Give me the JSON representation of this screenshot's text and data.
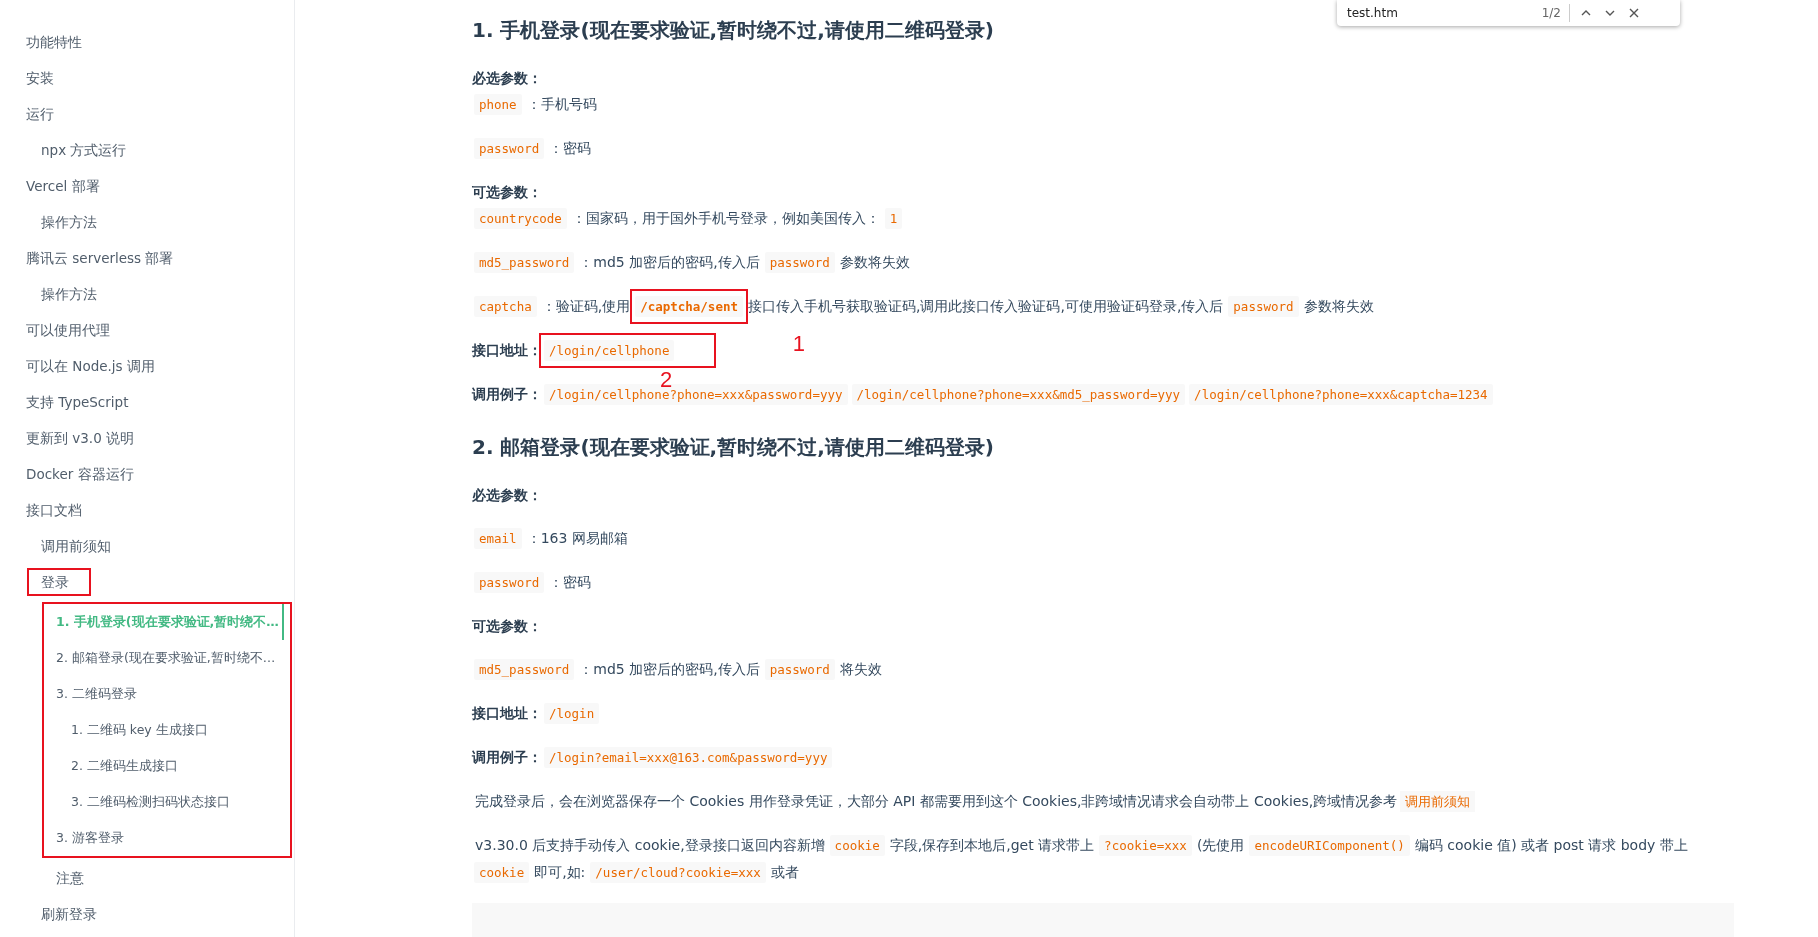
{
  "find_bar": {
    "query": "test.htm",
    "count": "1/2"
  },
  "sidebar": {
    "items": [
      {
        "label": "功能特性",
        "selected": false
      },
      {
        "label": "安装",
        "selected": false
      },
      {
        "label": "运行",
        "selected": false,
        "children": [
          {
            "label": "npx 方式运行",
            "selected": false
          }
        ]
      },
      {
        "label": "Vercel 部署",
        "selected": false,
        "children": [
          {
            "label": "操作方法",
            "selected": false
          }
        ]
      },
      {
        "label": "腾讯云 serverless 部署",
        "selected": false,
        "children": [
          {
            "label": "操作方法",
            "selected": false
          }
        ]
      },
      {
        "label": "可以使用代理",
        "selected": false
      },
      {
        "label": "可以在 Node.js 调用",
        "selected": false
      },
      {
        "label": "支持 TypeScript",
        "selected": false
      },
      {
        "label": "更新到 v3.0 说明",
        "selected": false
      },
      {
        "label": "Docker 容器运行",
        "selected": false
      },
      {
        "label": "接口文档",
        "selected": false,
        "children": [
          {
            "label": "调用前须知",
            "selected": false
          },
          {
            "label": "登录",
            "selected": false,
            "marked": true,
            "children": [
              {
                "label": "1. 手机登录(现在要求验证,暂时绕不…",
                "selected": true,
                "marked": true
              },
              {
                "label": "2. 邮箱登录(现在要求验证,暂时绕不…",
                "selected": false,
                "marked": true
              },
              {
                "label": "3. 二维码登录",
                "selected": false,
                "marked": true,
                "children": [
                  {
                    "label": "1. 二维码 key 生成接口",
                    "selected": false
                  },
                  {
                    "label": "2. 二维码生成接口",
                    "selected": false
                  },
                  {
                    "label": "3. 二维码检测扫码状态接口",
                    "selected": false
                  }
                ]
              },
              {
                "label": "3. 游客登录",
                "selected": false,
                "marked": true
              },
              {
                "label": "注意",
                "selected": false
              }
            ]
          },
          {
            "label": "刷新登录",
            "selected": false
          }
        ]
      }
    ]
  },
  "content": [
    {
      "kind": "heading",
      "text": "1. 手机登录(现在要求验证,暂时绕不过,请使用二维码登录)"
    },
    {
      "kind": "para",
      "segments": [
        {
          "kind": "label",
          "text": "必选参数："
        },
        {
          "kind": "br"
        },
        {
          "kind": "code",
          "text": "phone"
        },
        {
          "kind": "text",
          "text": "：手机号码"
        }
      ]
    },
    {
      "kind": "para",
      "segments": [
        {
          "kind": "code",
          "text": "password"
        },
        {
          "kind": "text",
          "text": "：密码"
        }
      ]
    },
    {
      "kind": "para",
      "segments": [
        {
          "kind": "label",
          "text": "可选参数："
        },
        {
          "kind": "br"
        },
        {
          "kind": "code",
          "text": "countrycode"
        },
        {
          "kind": "text",
          "text": "：国家码，用于国外手机号登录，例如美国传入："
        },
        {
          "kind": "code",
          "text": "1"
        }
      ]
    },
    {
      "kind": "para",
      "segments": [
        {
          "kind": "code",
          "text": "md5_password"
        },
        {
          "kind": "text",
          "text": "：md5 加密后的密码,传入后"
        },
        {
          "kind": "code",
          "text": "password"
        },
        {
          "kind": "text",
          "text": "参数将失效"
        }
      ]
    },
    {
      "kind": "para",
      "segments": [
        {
          "kind": "code",
          "text": "captcha"
        },
        {
          "kind": "text",
          "text": "：验证码,使用"
        },
        {
          "kind": "code",
          "text": "/captcha/sent",
          "bold": true,
          "marked": true,
          "callout": "1"
        },
        {
          "kind": "text",
          "text": "接口传入手机号获取验证码,调用此接口传入验证码,可使用验证码登录,传入后"
        },
        {
          "kind": "code",
          "text": "password"
        },
        {
          "kind": "text",
          "text": "参数将失效"
        }
      ]
    },
    {
      "kind": "para",
      "segments": [
        {
          "kind": "label",
          "text": "接口地址："
        },
        {
          "kind": "code",
          "text": "/login/cellphone",
          "marked": true,
          "callout": "2"
        }
      ]
    },
    {
      "kind": "para",
      "segments": [
        {
          "kind": "label",
          "text": "调用例子："
        },
        {
          "kind": "code",
          "text": "/login/cellphone?phone=xxx&password=yyy"
        },
        {
          "kind": "code",
          "text": "/login/cellphone?phone=xxx&md5_password=yyy"
        },
        {
          "kind": "code",
          "text": "/login/cellphone?phone=xxx&captcha=1234"
        }
      ]
    },
    {
      "kind": "heading",
      "text": "2. 邮箱登录(现在要求验证,暂时绕不过,请使用二维码登录)"
    },
    {
      "kind": "para",
      "segments": [
        {
          "kind": "label",
          "text": "必选参数："
        }
      ]
    },
    {
      "kind": "para",
      "segments": [
        {
          "kind": "code",
          "text": "email"
        },
        {
          "kind": "text",
          "text": "：163 网易邮箱"
        }
      ]
    },
    {
      "kind": "para",
      "segments": [
        {
          "kind": "code",
          "text": "password"
        },
        {
          "kind": "text",
          "text": "：密码"
        }
      ]
    },
    {
      "kind": "para",
      "segments": [
        {
          "kind": "label",
          "text": "可选参数："
        }
      ]
    },
    {
      "kind": "para",
      "segments": [
        {
          "kind": "code",
          "text": "md5_password"
        },
        {
          "kind": "text",
          "text": "：md5 加密后的密码,传入后"
        },
        {
          "kind": "code",
          "text": "password"
        },
        {
          "kind": "text",
          "text": "将失效"
        }
      ]
    },
    {
      "kind": "para",
      "segments": [
        {
          "kind": "label",
          "text": "接口地址："
        },
        {
          "kind": "code",
          "text": "/login"
        }
      ]
    },
    {
      "kind": "para",
      "segments": [
        {
          "kind": "label",
          "text": "调用例子："
        },
        {
          "kind": "code",
          "text": "/login?email=xxx@163.com&password=yyy"
        }
      ]
    },
    {
      "kind": "para",
      "segments": [
        {
          "kind": "text",
          "text": "完成登录后，会在浏览器保存一个 Cookies 用作登录凭证，大部分 API 都需要用到这个 Cookies,非跨域情况请求会自动带上 Cookies,跨域情况参考"
        },
        {
          "kind": "link",
          "text": "调用前须知"
        }
      ]
    },
    {
      "kind": "para",
      "segments": [
        {
          "kind": "text",
          "text": "v3.30.0 后支持手动传入 cookie,登录接口返回内容新增"
        },
        {
          "kind": "code",
          "text": "cookie"
        },
        {
          "kind": "text",
          "text": "字段,保存到本地后,get 请求带上"
        },
        {
          "kind": "code",
          "text": "?cookie=xxx"
        },
        {
          "kind": "text",
          "text": "(先使用"
        },
        {
          "kind": "code",
          "text": "encodeURIComponent()"
        },
        {
          "kind": "text",
          "text": "编码 cookie 值) 或者 post 请求 body 带上"
        },
        {
          "kind": "br"
        },
        {
          "kind": "code",
          "text": "cookie"
        },
        {
          "kind": "text",
          "text": "即可,如:"
        },
        {
          "kind": "code",
          "text": "/user/cloud?cookie=xxx"
        },
        {
          "kind": "text",
          "text": "或者"
        }
      ]
    },
    {
      "kind": "codeblock"
    }
  ]
}
